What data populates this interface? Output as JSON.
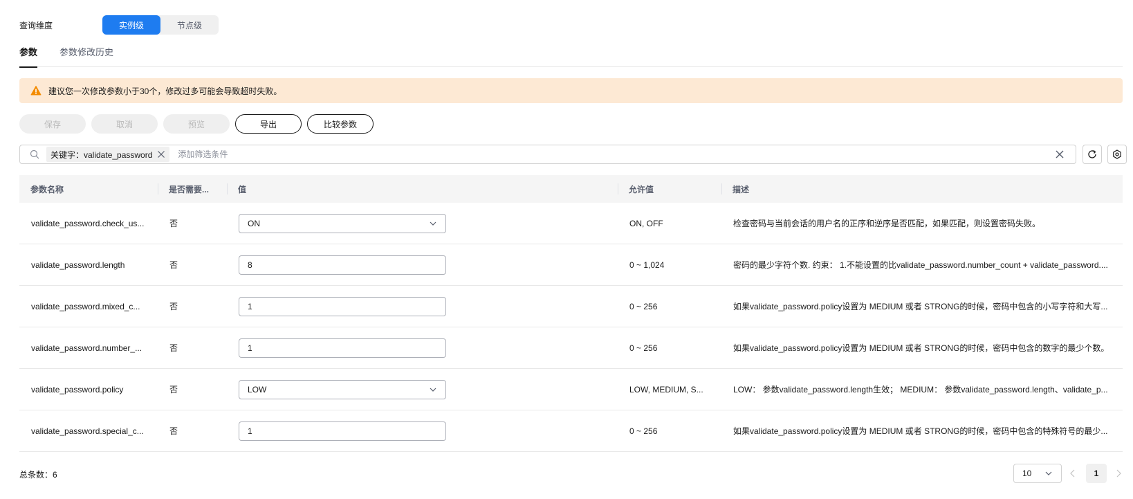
{
  "query_dimension": {
    "label": "查询维度",
    "options": [
      "实例级",
      "节点级"
    ],
    "selected": "实例级"
  },
  "tabs": [
    {
      "label": "参数",
      "active": true
    },
    {
      "label": "参数修改历史",
      "active": false
    }
  ],
  "alert": {
    "text": "建议您一次修改参数小于30个，修改过多可能会导致超时失败。",
    "icon": "warning-icon",
    "color": "#fde9d4",
    "icon_color": "#f38b00"
  },
  "toolbar": {
    "save_label": "保存",
    "cancel_label": "取消",
    "preview_label": "预览",
    "export_label": "导出",
    "compare_label": "比较参数"
  },
  "search": {
    "chip_label": "关键字：validate_password",
    "placeholder": "添加筛选条件"
  },
  "table": {
    "headers": [
      "参数名称",
      "是否需要...",
      "值",
      "允许值",
      "描述"
    ],
    "rows": [
      {
        "name": "validate_password.check_us...",
        "restart": "否",
        "value": "ON",
        "type": "select",
        "allowed": "ON, OFF",
        "desc": "检查密码与当前会话的用户名的正序和逆序是否匹配，如果匹配，则设置密码失败。"
      },
      {
        "name": "validate_password.length",
        "restart": "否",
        "value": "8",
        "type": "input",
        "allowed": "0 ~ 1,024",
        "desc": "密码的最少字符个数. 约束： 1.不能设置的比validate_password.number_count + validate_password...."
      },
      {
        "name": "validate_password.mixed_c...",
        "restart": "否",
        "value": "1",
        "type": "input",
        "allowed": "0 ~ 256",
        "desc": "如果validate_password.policy设置为 MEDIUM 或者 STRONG的时候，密码中包含的小写字符和大写..."
      },
      {
        "name": "validate_password.number_...",
        "restart": "否",
        "value": "1",
        "type": "input",
        "allowed": "0 ~ 256",
        "desc": "如果validate_password.policy设置为 MEDIUM 或者 STRONG的时候，密码中包含的数字的最少个数。"
      },
      {
        "name": "validate_password.policy",
        "restart": "否",
        "value": "LOW",
        "type": "select",
        "allowed": "LOW, MEDIUM, S...",
        "desc": "LOW： 参数validate_password.length生效； MEDIUM： 参数validate_password.length、validate_p..."
      },
      {
        "name": "validate_password.special_c...",
        "restart": "否",
        "value": "1",
        "type": "input",
        "allowed": "0 ~ 256",
        "desc": "如果validate_password.policy设置为 MEDIUM 或者 STRONG的时候，密码中包含的特殊符号的最少..."
      }
    ]
  },
  "footer": {
    "total_label": "总条数：6",
    "page_size": "10",
    "current_page": "1"
  },
  "colors": {
    "primary": "#1e7cf0",
    "text": "#191919"
  }
}
